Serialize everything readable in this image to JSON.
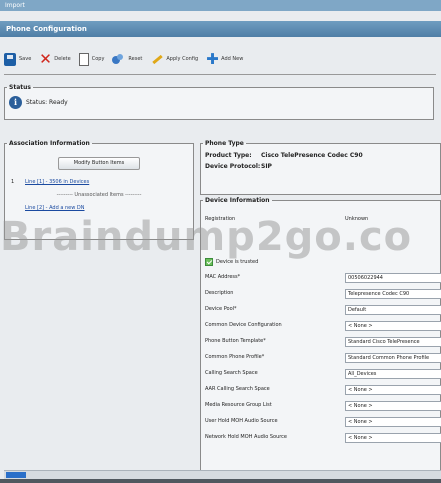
{
  "window": {
    "title": "Import"
  },
  "page": {
    "header": "Phone Configuration"
  },
  "toolbar": {
    "save": "Save",
    "delete": "Delete",
    "copy": "Copy",
    "reset": "Reset",
    "apply_config": "Apply Config",
    "add_new": "Add New"
  },
  "status": {
    "legend": "Status",
    "text": "Status: Ready"
  },
  "association": {
    "legend": "Association Information",
    "modify_button": "Modify Button Items",
    "line1_num": "1",
    "line1_label": "Line [1] - 3506 in Devices",
    "unassociated": "Unassociated Items",
    "line2_label": "Line [2] - Add a new DN"
  },
  "phone_type": {
    "legend": "Phone Type",
    "product_type_key": "Product Type:",
    "product_type_value": "Cisco TelePresence Codec C90",
    "device_protocol_key": "Device Protocol:",
    "device_protocol_value": "SIP"
  },
  "device_info": {
    "legend": "Device Information",
    "registration_key": "Registration",
    "registration_value": "Unknown",
    "device_trusted": "Device is trusted",
    "mac_address_label": "MAC Address*",
    "mac_address_value": "00506022944",
    "description_label": "Description",
    "description_value": "Telepresence Codec C90",
    "device_pool_label": "Device Pool*",
    "device_pool_value": "Default",
    "common_device_config_label": "Common Device Configuration",
    "common_device_config_value": "< None >",
    "phone_button_template_label": "Phone Button Template*",
    "phone_button_template_value": "Standard Cisco TelePresence",
    "common_phone_profile_label": "Common Phone Profile*",
    "common_phone_profile_value": "Standard Common Phone Profile",
    "calling_search_space_label": "Calling Search Space",
    "calling_search_space_value": "All_Devices",
    "aar_css_label": "AAR Calling Search Space",
    "aar_css_value": "< None >",
    "mrgl_label": "Media Resource Group List",
    "mrgl_value": "< None >",
    "user_hold_label": "User Hold MOH Audio Source",
    "user_hold_value": "< None >",
    "network_hold_label": "Network Hold MOH Audio Source",
    "network_hold_value": "< None >"
  },
  "watermark": "Braindump2go.co"
}
